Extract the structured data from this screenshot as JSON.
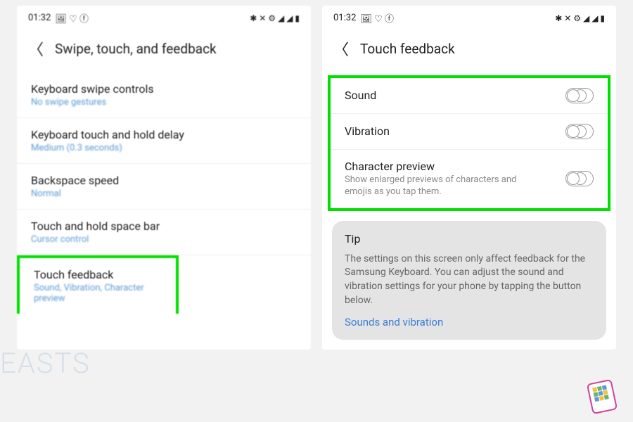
{
  "left": {
    "status": {
      "time": "01:32",
      "icons_left": "🖼 ♡ ⓕ",
      "icons_right": "✱ ✕ ⚙ ◢ ◢ ▮"
    },
    "header": {
      "title": "Swipe, touch, and feedback"
    },
    "items": [
      {
        "title": "Keyboard swipe controls",
        "sub": "No swipe gestures"
      },
      {
        "title": "Keyboard touch and hold delay",
        "sub": "Medium (0.3 seconds)"
      },
      {
        "title": "Backspace speed",
        "sub": "Normal"
      },
      {
        "title": "Touch and hold space bar",
        "sub": "Cursor control"
      },
      {
        "title": "Touch feedback",
        "sub": "Sound, Vibration, Character preview"
      }
    ]
  },
  "right": {
    "status": {
      "time": "01:32",
      "icons_left": "🖼 ♡ ⓕ",
      "icons_right": "✱ ✕ ⚙ ◢ ◢ ▮"
    },
    "header": {
      "title": "Touch feedback"
    },
    "toggles": [
      {
        "title": "Sound",
        "sub": ""
      },
      {
        "title": "Vibration",
        "sub": ""
      },
      {
        "title": "Character preview",
        "sub": "Show enlarged previews of characters and emojis as you tap them."
      }
    ],
    "tip": {
      "title": "Tip",
      "body": "The settings on this screen only affect feedback for the Samsung Keyboard. You can adjust the sound and vibration settings for your phone by tapping the button below.",
      "link": "Sounds and vibration"
    }
  },
  "watermark": "EASTS"
}
